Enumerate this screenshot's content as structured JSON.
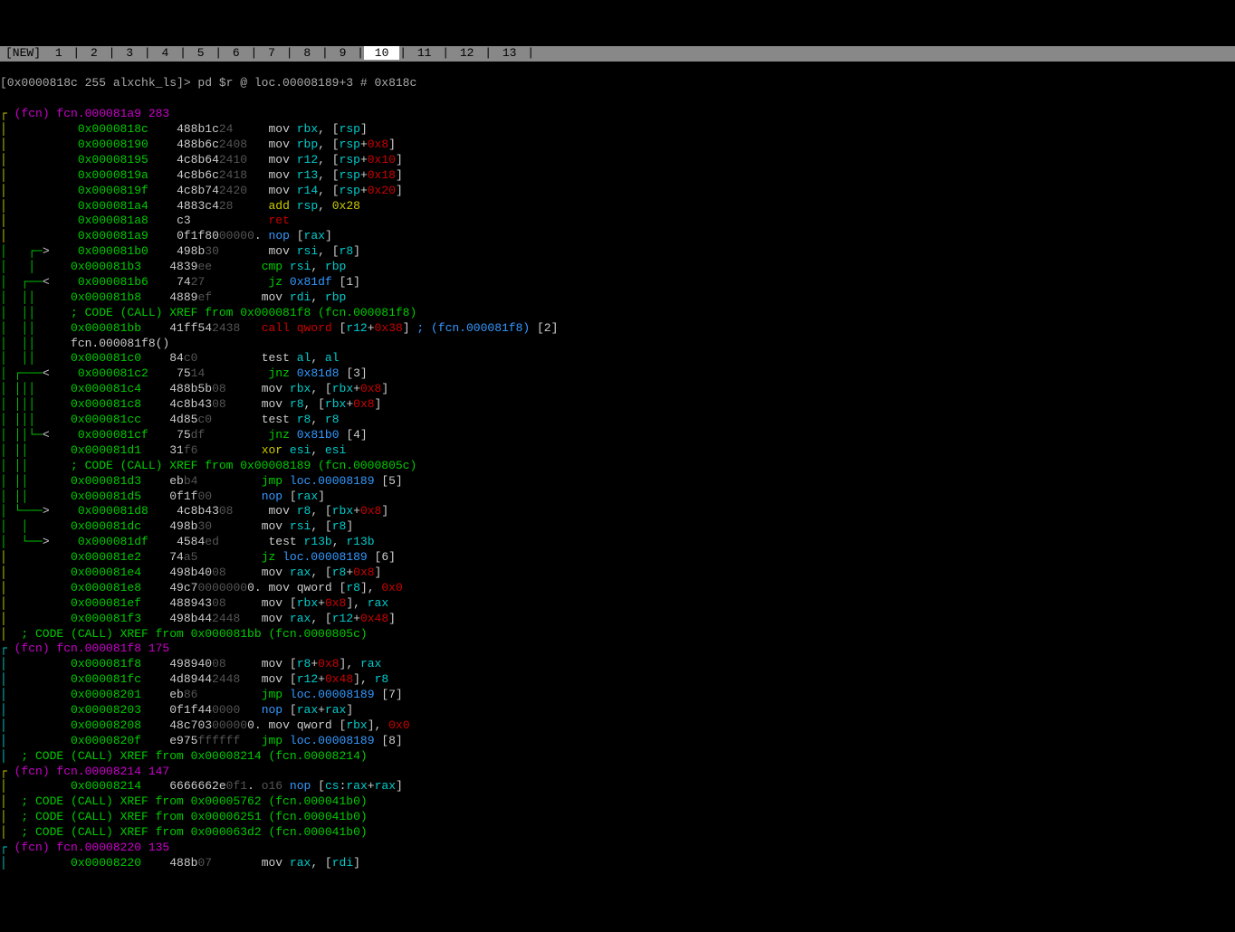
{
  "tabs": {
    "new": "[NEW]",
    "nums": [
      " 1 ",
      " 2 ",
      " 3 ",
      " 4 ",
      " 5 ",
      " 6 ",
      " 7 ",
      " 8 ",
      " 9 ",
      " 10 ",
      " 11 ",
      " 12 ",
      " 13 "
    ],
    "active_index": 9
  },
  "prompt": "[0x0000818c 255 alxchk_ls]> pd $r @ loc.00008189+3 # 0x818c",
  "lines": [
    {
      "pre": "┌ ",
      "precls": "arrow-y",
      "txt": "(fcn) fcn.000081a9 283",
      "cls": "fcnhead"
    },
    {
      "pre": "│          ",
      "precls": "arrow-y",
      "addr": "0x0000818c",
      "hex": "488b1c",
      "hd": "24",
      "inst": [
        [
          "mnemonic",
          "mov "
        ],
        [
          "reg",
          "rbx"
        ],
        [
          "white",
          ", ["
        ],
        [
          "reg",
          "rsp"
        ],
        [
          "white",
          "]"
        ]
      ]
    },
    {
      "pre": "│          ",
      "precls": "arrow-y",
      "addr": "0x00008190",
      "hex": "488b6c",
      "hd": "2408",
      "inst": [
        [
          "mnemonic",
          "mov "
        ],
        [
          "reg",
          "rbp"
        ],
        [
          "white",
          ", ["
        ],
        [
          "reg",
          "rsp"
        ],
        [
          "white",
          "+"
        ],
        [
          "hexoff",
          "0x8"
        ],
        [
          "white",
          "]"
        ]
      ]
    },
    {
      "pre": "│          ",
      "precls": "arrow-y",
      "addr": "0x00008195",
      "hex": "4c8b64",
      "hd": "2410",
      "inst": [
        [
          "mnemonic",
          "mov "
        ],
        [
          "reg",
          "r12"
        ],
        [
          "white",
          ", ["
        ],
        [
          "reg",
          "rsp"
        ],
        [
          "white",
          "+"
        ],
        [
          "hexoff",
          "0x10"
        ],
        [
          "white",
          "]"
        ]
      ]
    },
    {
      "pre": "│          ",
      "precls": "arrow-y",
      "addr": "0x0000819a",
      "hex": "4c8b6c",
      "hd": "2418",
      "inst": [
        [
          "mnemonic",
          "mov "
        ],
        [
          "reg",
          "r13"
        ],
        [
          "white",
          ", ["
        ],
        [
          "reg",
          "rsp"
        ],
        [
          "white",
          "+"
        ],
        [
          "hexoff",
          "0x18"
        ],
        [
          "white",
          "]"
        ]
      ]
    },
    {
      "pre": "│          ",
      "precls": "arrow-y",
      "addr": "0x0000819f",
      "hex": "4c8b74",
      "hd": "2420",
      "inst": [
        [
          "mnemonic",
          "mov "
        ],
        [
          "reg",
          "r14"
        ],
        [
          "white",
          ", ["
        ],
        [
          "reg",
          "rsp"
        ],
        [
          "white",
          "+"
        ],
        [
          "hexoff",
          "0x20"
        ],
        [
          "white",
          "]"
        ]
      ]
    },
    {
      "pre": "│          ",
      "precls": "arrow-y",
      "addr": "0x000081a4",
      "hex": "4883c4",
      "hd": "28",
      "inst": [
        [
          "add",
          "add "
        ],
        [
          "reg",
          "rsp"
        ],
        [
          "white",
          ", "
        ],
        [
          "num",
          "0x28"
        ]
      ]
    },
    {
      "pre": "│          ",
      "precls": "arrow-y",
      "addr": "0x000081a8",
      "hex": "c3",
      "hd": "",
      "inst": [
        [
          "ret",
          "ret"
        ]
      ]
    },
    {
      "pre": "│          ",
      "precls": "arrow-y",
      "addr": "0x000081a9",
      "hex": "0f1f80",
      "hd": "00000",
      "hdot": ".",
      "inst": [
        [
          "nop",
          "nop "
        ],
        [
          "white",
          "["
        ],
        [
          "reg",
          "rax"
        ],
        [
          "white",
          "]"
        ]
      ]
    },
    {
      "pre": "│   ┌─",
      "precls": "arrow-g",
      "mid": "> ",
      "addr": "0x000081b0",
      "hex": "498b",
      "hd": "30",
      "inst": [
        [
          "mnemonic",
          "mov "
        ],
        [
          "reg",
          "rsi"
        ],
        [
          "white",
          ", ["
        ],
        [
          "reg",
          "r8"
        ],
        [
          "white",
          "]"
        ]
      ]
    },
    {
      "pre": "│   │     ",
      "precls": "arrow-g",
      "addr": "0x000081b3",
      "hex": "4839",
      "hd": "ee",
      "inst": [
        [
          "jmp",
          "cmp "
        ],
        [
          "reg",
          "rsi"
        ],
        [
          "white",
          ", "
        ],
        [
          "reg",
          "rbp"
        ]
      ]
    },
    {
      "pre": "│  ┌──",
      "precls": "arrow-g",
      "mid": "< ",
      "addr": "0x000081b6",
      "hex": "74",
      "hd": "27",
      "inst": [
        [
          "jmp",
          "jz "
        ],
        [
          "jmpref",
          "0x81df"
        ],
        [
          "white",
          " [1]"
        ]
      ]
    },
    {
      "pre": "│  ││     ",
      "precls": "arrow-g",
      "addr": "0x000081b8",
      "hex": "4889",
      "hd": "ef",
      "inst": [
        [
          "mnemonic",
          "mov "
        ],
        [
          "reg",
          "rdi"
        ],
        [
          "white",
          ", "
        ],
        [
          "reg",
          "rbp"
        ]
      ]
    },
    {
      "pre": "│  ││  ",
      "precls": "arrow-g",
      "txt": "   ; CODE (CALL) XREF from 0x000081f8 (fcn.000081f8)",
      "cls": "xref"
    },
    {
      "pre": "│  ││     ",
      "precls": "arrow-g",
      "addr": "0x000081bb",
      "hex": "41ff54",
      "hd": "2438",
      "inst": [
        [
          "call",
          "call qword "
        ],
        [
          "white",
          "["
        ],
        [
          "reg",
          "r12"
        ],
        [
          "white",
          "+"
        ],
        [
          "hexoff",
          "0x38"
        ],
        [
          "white",
          "] "
        ],
        [
          "comment",
          "; (fcn.000081f8) "
        ],
        [
          "white",
          "[2]"
        ]
      ]
    },
    {
      "pre": "│  ││  ",
      "precls": "arrow-g",
      "txt": "   fcn.000081f8()",
      "cls": "white"
    },
    {
      "pre": "│  ││     ",
      "precls": "arrow-g",
      "addr": "0x000081c0",
      "hex": "84",
      "hd": "c0",
      "inst": [
        [
          "test",
          "test "
        ],
        [
          "reg",
          "al"
        ],
        [
          "white",
          ", "
        ],
        [
          "reg",
          "al"
        ]
      ]
    },
    {
      "pre": "│ ┌───",
      "precls": "arrow-g",
      "mid": "< ",
      "addr": "0x000081c2",
      "hex": "75",
      "hd": "14",
      "inst": [
        [
          "jmp",
          "jnz "
        ],
        [
          "jmpref",
          "0x81d8"
        ],
        [
          "white",
          " [3]"
        ]
      ]
    },
    {
      "pre": "│ │││     ",
      "precls": "arrow-g",
      "addr": "0x000081c4",
      "hex": "488b5b",
      "hd": "08",
      "inst": [
        [
          "mnemonic",
          "mov "
        ],
        [
          "reg",
          "rbx"
        ],
        [
          "white",
          ", ["
        ],
        [
          "reg",
          "rbx"
        ],
        [
          "white",
          "+"
        ],
        [
          "hexoff",
          "0x8"
        ],
        [
          "white",
          "]"
        ]
      ]
    },
    {
      "pre": "│ │││     ",
      "precls": "arrow-g",
      "addr": "0x000081c8",
      "hex": "4c8b43",
      "hd": "08",
      "inst": [
        [
          "mnemonic",
          "mov "
        ],
        [
          "reg",
          "r8"
        ],
        [
          "white",
          ", ["
        ],
        [
          "reg",
          "rbx"
        ],
        [
          "white",
          "+"
        ],
        [
          "hexoff",
          "0x8"
        ],
        [
          "white",
          "]"
        ]
      ]
    },
    {
      "pre": "│ │││     ",
      "precls": "arrow-g",
      "addr": "0x000081cc",
      "hex": "4d85",
      "hd": "c0",
      "inst": [
        [
          "test",
          "test "
        ],
        [
          "reg",
          "r8"
        ],
        [
          "white",
          ", "
        ],
        [
          "reg",
          "r8"
        ]
      ]
    },
    {
      "pre": "│ ││└─",
      "precls": "arrow-g",
      "mid": "< ",
      "addr": "0x000081cf",
      "hex": "75",
      "hd": "df",
      "inst": [
        [
          "jmp",
          "jnz "
        ],
        [
          "jmpref",
          "0x81b0"
        ],
        [
          "white",
          " [4]"
        ]
      ]
    },
    {
      "pre": "│ ││      ",
      "precls": "arrow-g",
      "addr": "0x000081d1",
      "hex": "31",
      "hd": "f6",
      "inst": [
        [
          "add",
          "xor "
        ],
        [
          "reg",
          "esi"
        ],
        [
          "white",
          ", "
        ],
        [
          "reg",
          "esi"
        ]
      ]
    },
    {
      "pre": "│ ││   ",
      "precls": "arrow-g",
      "txt": "   ; CODE (CALL) XREF from 0x00008189 (fcn.0000805c)",
      "cls": "xref"
    },
    {
      "pre": "│ ││      ",
      "precls": "arrow-g",
      "addr": "0x000081d3",
      "hex": "eb",
      "hd": "b4",
      "inst": [
        [
          "jmp",
          "jmp "
        ],
        [
          "loc",
          "loc.00008189"
        ],
        [
          "white",
          " [5]"
        ]
      ]
    },
    {
      "pre": "│ ││      ",
      "precls": "arrow-g",
      "addr": "0x000081d5",
      "hex": "0f1f",
      "hd": "00",
      "inst": [
        [
          "nop",
          "nop "
        ],
        [
          "white",
          "["
        ],
        [
          "reg",
          "rax"
        ],
        [
          "white",
          "]"
        ]
      ]
    },
    {
      "pre": "│ └───",
      "precls": "arrow-g",
      "mid": "> ",
      "addr": "0x000081d8",
      "hex": "4c8b43",
      "hd": "08",
      "inst": [
        [
          "mnemonic",
          "mov "
        ],
        [
          "reg",
          "r8"
        ],
        [
          "white",
          ", ["
        ],
        [
          "reg",
          "rbx"
        ],
        [
          "white",
          "+"
        ],
        [
          "hexoff",
          "0x8"
        ],
        [
          "white",
          "]"
        ]
      ]
    },
    {
      "pre": "│  │      ",
      "precls": "arrow-g",
      "addr": "0x000081dc",
      "hex": "498b",
      "hd": "30",
      "inst": [
        [
          "mnemonic",
          "mov "
        ],
        [
          "reg",
          "rsi"
        ],
        [
          "white",
          ", ["
        ],
        [
          "reg",
          "r8"
        ],
        [
          "white",
          "]"
        ]
      ]
    },
    {
      "pre": "│  └──",
      "precls": "arrow-g",
      "mid": "> ",
      "addr": "0x000081df",
      "hex": "4584",
      "hd": "ed",
      "inst": [
        [
          "test",
          "test "
        ],
        [
          "reg",
          "r13b"
        ],
        [
          "white",
          ", "
        ],
        [
          "reg",
          "r13b"
        ]
      ]
    },
    {
      "pre": "│         ",
      "precls": "arrow-y",
      "addr": "0x000081e2",
      "hex": "74",
      "hd": "a5",
      "inst": [
        [
          "jmp",
          "jz "
        ],
        [
          "loc",
          "loc.00008189"
        ],
        [
          "white",
          " [6]"
        ]
      ]
    },
    {
      "pre": "│         ",
      "precls": "arrow-y",
      "addr": "0x000081e4",
      "hex": "498b40",
      "hd": "08",
      "inst": [
        [
          "mnemonic",
          "mov "
        ],
        [
          "reg",
          "rax"
        ],
        [
          "white",
          ", ["
        ],
        [
          "reg",
          "r8"
        ],
        [
          "white",
          "+"
        ],
        [
          "hexoff",
          "0x8"
        ],
        [
          "white",
          "]"
        ]
      ]
    },
    {
      "pre": "│         ",
      "precls": "arrow-y",
      "addr": "0x000081e8",
      "hex": "49c7",
      "hd": "0000000",
      "hdot": "0.",
      "inst": [
        [
          "mnemonic",
          "mov qword "
        ],
        [
          "white",
          "["
        ],
        [
          "reg",
          "r8"
        ],
        [
          "white",
          "], "
        ],
        [
          "hexoff",
          "0x0"
        ]
      ]
    },
    {
      "pre": "│         ",
      "precls": "arrow-y",
      "addr": "0x000081ef",
      "hex": "488943",
      "hd": "08",
      "inst": [
        [
          "mnemonic",
          "mov "
        ],
        [
          "white",
          "["
        ],
        [
          "reg",
          "rbx"
        ],
        [
          "white",
          "+"
        ],
        [
          "hexoff",
          "0x8"
        ],
        [
          "white",
          "], "
        ],
        [
          "reg",
          "rax"
        ]
      ]
    },
    {
      "pre": "│         ",
      "precls": "arrow-y",
      "addr": "0x000081f3",
      "hex": "498b44",
      "hd": "2448",
      "inst": [
        [
          "mnemonic",
          "mov "
        ],
        [
          "reg",
          "rax"
        ],
        [
          "white",
          ", ["
        ],
        [
          "reg",
          "r12"
        ],
        [
          "white",
          "+"
        ],
        [
          "hexoff",
          "0x48"
        ],
        [
          "white",
          "]"
        ]
      ]
    },
    {
      "pre": "│  ",
      "precls": "arrow-y",
      "txt": "; CODE (CALL) XREF from 0x000081bb (fcn.0000805c)",
      "cls": "xref"
    },
    {
      "pre": "┌ ",
      "precls": "arrow-c",
      "txt": "(fcn) fcn.000081f8 175",
      "cls": "fcnhead"
    },
    {
      "pre": "│         ",
      "precls": "arrow-c",
      "addr": "0x000081f8",
      "hex": "498940",
      "hd": "08",
      "inst": [
        [
          "mnemonic",
          "mov "
        ],
        [
          "white",
          "["
        ],
        [
          "reg",
          "r8"
        ],
        [
          "white",
          "+"
        ],
        [
          "hexoff",
          "0x8"
        ],
        [
          "white",
          "], "
        ],
        [
          "reg",
          "rax"
        ]
      ]
    },
    {
      "pre": "│         ",
      "precls": "arrow-c",
      "addr": "0x000081fc",
      "hex": "4d8944",
      "hd": "2448",
      "inst": [
        [
          "mnemonic",
          "mov "
        ],
        [
          "white",
          "["
        ],
        [
          "reg",
          "r12"
        ],
        [
          "white",
          "+"
        ],
        [
          "hexoff",
          "0x48"
        ],
        [
          "white",
          "], "
        ],
        [
          "reg",
          "r8"
        ]
      ]
    },
    {
      "pre": "│         ",
      "precls": "arrow-c",
      "addr": "0x00008201",
      "hex": "eb",
      "hd": "86",
      "inst": [
        [
          "jmp",
          "jmp "
        ],
        [
          "loc",
          "loc.00008189"
        ],
        [
          "white",
          " [7]"
        ]
      ]
    },
    {
      "pre": "│         ",
      "precls": "arrow-c",
      "addr": "0x00008203",
      "hex": "0f1f44",
      "hd": "0000",
      "inst": [
        [
          "nop",
          "nop "
        ],
        [
          "white",
          "["
        ],
        [
          "reg",
          "rax"
        ],
        [
          "white",
          "+"
        ],
        [
          "reg",
          "rax"
        ],
        [
          "white",
          "]"
        ]
      ]
    },
    {
      "pre": "│         ",
      "precls": "arrow-c",
      "addr": "0x00008208",
      "hex": "48c703",
      "hd": "00000",
      "hdot": "0.",
      "inst": [
        [
          "mnemonic",
          "mov qword "
        ],
        [
          "white",
          "["
        ],
        [
          "reg",
          "rbx"
        ],
        [
          "white",
          "], "
        ],
        [
          "hexoff",
          "0x0"
        ]
      ]
    },
    {
      "pre": "│         ",
      "precls": "arrow-c",
      "addr": "0x0000820f",
      "hex": "e975",
      "hd": "ffffff",
      "inst": [
        [
          "jmp",
          "jmp "
        ],
        [
          "loc",
          "loc.00008189"
        ],
        [
          "white",
          " [8]"
        ]
      ]
    },
    {
      "pre": "│  ",
      "precls": "arrow-c",
      "txt": "; CODE (CALL) XREF from 0x00008214 (fcn.00008214)",
      "cls": "xref"
    },
    {
      "pre": "┌ ",
      "precls": "arrow-y",
      "txt": "(fcn) fcn.00008214 147",
      "cls": "fcnhead"
    },
    {
      "pre": "│         ",
      "precls": "arrow-y",
      "addr": "0x00008214",
      "hex": "6666662e",
      "hd": "0f1",
      "hdot": ".",
      "inst": [
        [
          "o16",
          "o16 "
        ],
        [
          "nop",
          "nop "
        ],
        [
          "white",
          "["
        ],
        [
          "reg",
          "cs"
        ],
        [
          "white",
          ":"
        ],
        [
          "reg",
          "rax"
        ],
        [
          "white",
          "+"
        ],
        [
          "reg",
          "rax"
        ],
        [
          "white",
          "]"
        ]
      ]
    },
    {
      "pre": "│  ",
      "precls": "arrow-y",
      "txt": "; CODE (CALL) XREF from 0x00005762 (fcn.000041b0)",
      "cls": "xref"
    },
    {
      "pre": "│  ",
      "precls": "arrow-y",
      "txt": "; CODE (CALL) XREF from 0x00006251 (fcn.000041b0)",
      "cls": "xref"
    },
    {
      "pre": "│  ",
      "precls": "arrow-y",
      "txt": "; CODE (CALL) XREF from 0x000063d2 (fcn.000041b0)",
      "cls": "xref"
    },
    {
      "pre": "┌ ",
      "precls": "arrow-c",
      "txt": "(fcn) fcn.00008220 135",
      "cls": "fcnhead"
    },
    {
      "pre": "│         ",
      "precls": "arrow-c",
      "addr": "0x00008220",
      "hex": "488b",
      "hd": "07",
      "inst": [
        [
          "mnemonic",
          "mov "
        ],
        [
          "reg",
          "rax"
        ],
        [
          "white",
          ", ["
        ],
        [
          "reg",
          "rdi"
        ],
        [
          "white",
          "]"
        ]
      ]
    }
  ]
}
